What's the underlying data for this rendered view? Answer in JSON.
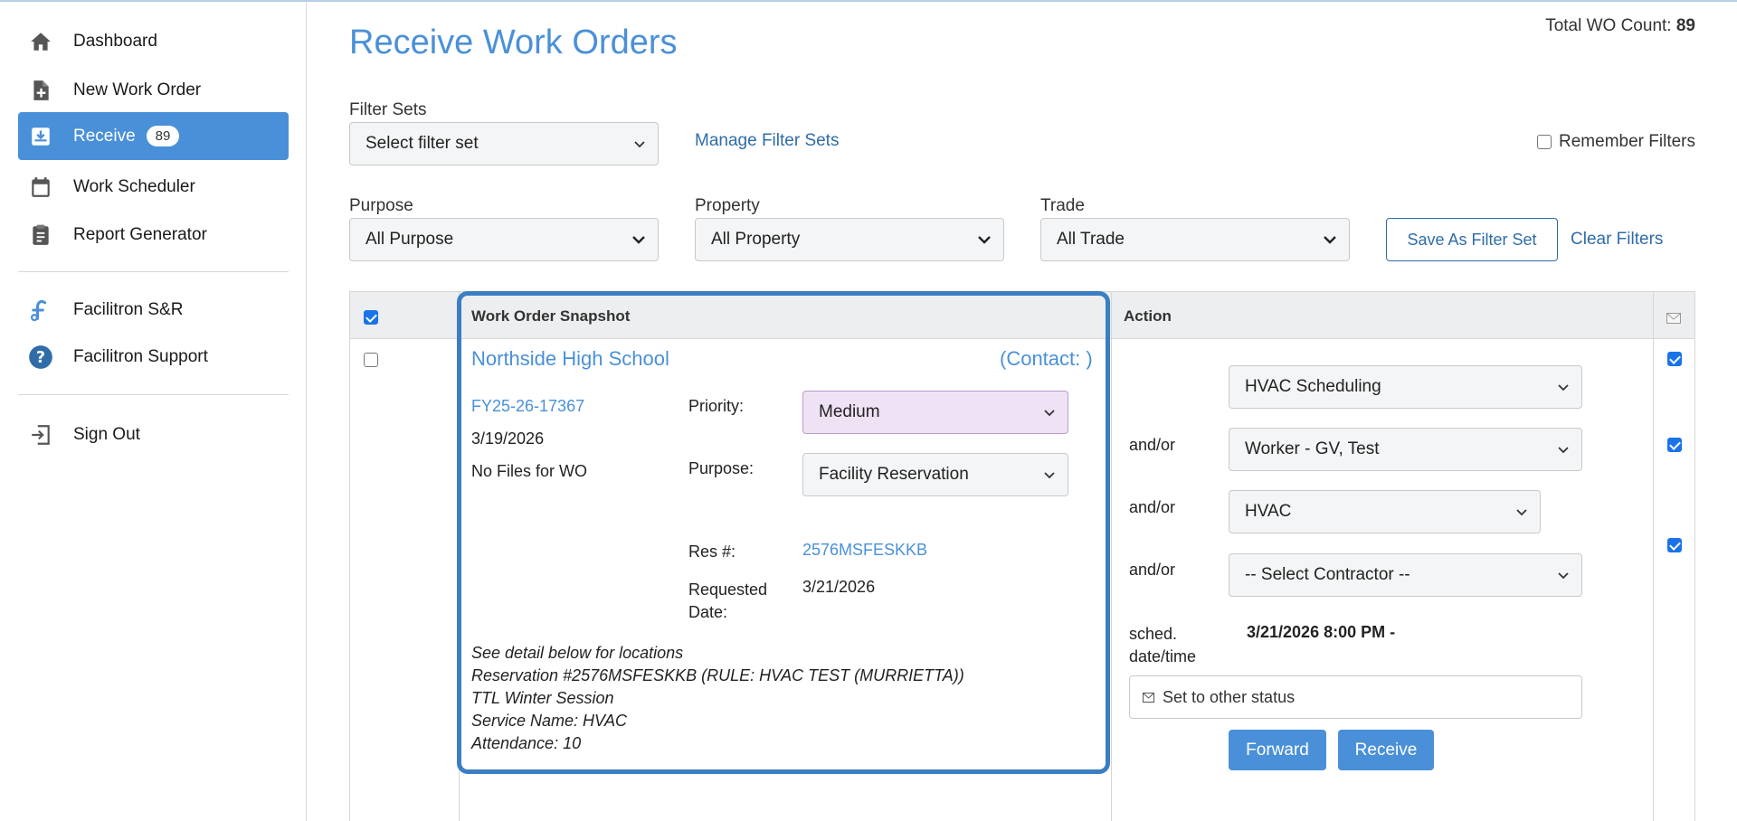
{
  "sidebar": {
    "items": [
      {
        "label": "Dashboard",
        "icon": "home-icon"
      },
      {
        "label": "New Work Order",
        "icon": "file-plus-icon"
      },
      {
        "label": "Receive",
        "icon": "inbox-download-icon",
        "badge": "89"
      },
      {
        "label": "Work Scheduler",
        "icon": "calendar-icon"
      },
      {
        "label": "Report Generator",
        "icon": "clipboard-icon"
      }
    ],
    "links": [
      {
        "label": "Facilitron S&R",
        "icon": "facilitron-logo-icon"
      },
      {
        "label": "Facilitron Support",
        "icon": "help-circle-icon"
      }
    ],
    "signout": {
      "label": "Sign Out",
      "icon": "sign-out-icon"
    }
  },
  "header": {
    "title": "Receive Work Orders",
    "count_label": "Total WO Count:",
    "count_value": "89"
  },
  "filters": {
    "filter_sets_label": "Filter Sets",
    "filter_sets_value": "Select filter set",
    "manage_link": "Manage Filter Sets",
    "remember_label": "Remember Filters",
    "purpose_label": "Purpose",
    "purpose_value": "All Purpose",
    "property_label": "Property",
    "property_value": "All Property",
    "trade_label": "Trade",
    "trade_value": "All Trade",
    "save_button": "Save As Filter Set",
    "clear_link": "Clear Filters"
  },
  "table": {
    "col_snapshot": "Work Order Snapshot",
    "col_action": "Action"
  },
  "row": {
    "school": "Northside High School",
    "contact": "(Contact: )",
    "wo_number": "FY25-26-17367",
    "date": "3/19/2026",
    "files": "No Files for WO",
    "priority_label": "Priority:",
    "priority_value": "Medium",
    "purpose_label": "Purpose:",
    "purpose_value": "Facility Reservation",
    "res_label": "Res #:",
    "res_value": "2576MSFESKKB",
    "requested_label_1": "Requested",
    "requested_label_2": "Date:",
    "requested_value": "3/21/2026",
    "description": [
      "See detail below for locations",
      "Reservation #2576MSFESKKB (RULE: HVAC TEST (MURRIETTA))",
      "TTL Winter Session",
      "Service Name: HVAC",
      "Attendance: 10"
    ]
  },
  "action": {
    "scheduling_value": "HVAC Scheduling",
    "andor": "and/or",
    "worker_value": "Worker - GV, Test",
    "trade_value": "HVAC",
    "contractor_value": "-- Select Contractor --",
    "sched_label_1": "sched.",
    "sched_label_2": "date/time",
    "sched_value": "3/21/2026 8:00 PM -",
    "status_value": "Set to other status",
    "forward_button": "Forward",
    "receive_button": "Receive"
  },
  "colors": {
    "accent": "#4a90d9",
    "link": "#2f6ca8",
    "highlight_border": "#3b7ec3",
    "priority_bg": "#efe2f5"
  }
}
